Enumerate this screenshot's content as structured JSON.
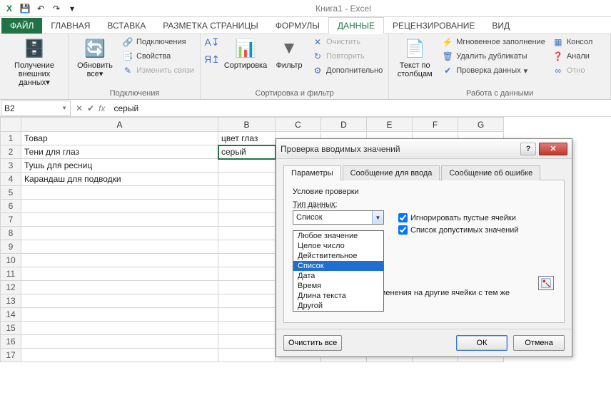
{
  "window": {
    "title": "Книга1 - Excel"
  },
  "qat": {
    "save": "💾",
    "undo": "↶",
    "redo": "↷"
  },
  "ribbon": {
    "tabs": {
      "file": "ФАЙЛ",
      "home": "ГЛАВНАЯ",
      "insert": "ВСТАВКА",
      "layout": "РАЗМЕТКА СТРАНИЦЫ",
      "formulas": "ФОРМУЛЫ",
      "data": "ДАННЫЕ",
      "review": "РЕЦЕНЗИРОВАНИЕ",
      "view": "ВИД"
    },
    "groups": {
      "getdata": {
        "label": "",
        "button": "Получение внешних данных",
        "dd": "▾"
      },
      "connections": {
        "label": "Подключения",
        "refresh": "Обновить все",
        "connections": "Подключения",
        "properties": "Свойства",
        "editlinks": "Изменить связи"
      },
      "sortfilter": {
        "label": "Сортировка и фильтр",
        "sortAZ": "А↧Я",
        "sortZA": "Я↥А",
        "sort": "Сортировка",
        "filter": "Фильтр",
        "clear": "Очистить",
        "reapply": "Повторить",
        "advanced": "Дополнительно"
      },
      "datatools": {
        "label": "Работа с данными",
        "ttc": "Текст по столбцам",
        "flash": "Мгновенное заполнение",
        "dupes": "Удалить дубликаты",
        "validation": "Проверка данных",
        "consolidate": "Консол",
        "whatif": "Анали",
        "relations": "Отно"
      }
    }
  },
  "formula": {
    "namebox": "B2",
    "value": "серый"
  },
  "columns": [
    "A",
    "B",
    "C",
    "D",
    "E",
    "F",
    "G"
  ],
  "rows": [
    "1",
    "2",
    "3",
    "4",
    "5",
    "6",
    "7",
    "8",
    "9",
    "10",
    "11",
    "12",
    "13",
    "14",
    "15",
    "16",
    "17"
  ],
  "cells": {
    "A1": "Товар",
    "B1": "цвет глаз",
    "A2": "Тени для глаз",
    "B2": "серый",
    "A3": "Тушь для ресниц",
    "A4": "Карандаш для подводки"
  },
  "dialog": {
    "title": "Проверка вводимых значений",
    "tabs": {
      "params": "Параметры",
      "input": "Сообщение для ввода",
      "error": "Сообщение об ошибке"
    },
    "cond_title": "Условие проверки",
    "type_label": "Тип данных:",
    "type_value": "Список",
    "options": [
      "Любое значение",
      "Целое число",
      "Действительное",
      "Список",
      "Дата",
      "Время",
      "Длина текста",
      "Другой"
    ],
    "ignore_blank": "Игнорировать пустые ячейки",
    "dropdown_list": "Список допустимых значений",
    "propagate": "Распространить изменения на другие ячейки с тем же условием",
    "clear": "Очистить все",
    "ok": "ОК",
    "cancel": "Отмена"
  }
}
